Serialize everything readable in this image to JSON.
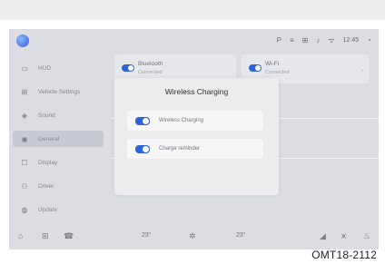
{
  "status": {
    "icons": [
      "P",
      "≡",
      "⊞",
      "♪",
      "ᯤ",
      "◔"
    ],
    "time": "12:45"
  },
  "sidebar": {
    "items": [
      {
        "icon": "▭",
        "label": "HUD"
      },
      {
        "icon": "⊞",
        "label": "Vehicle Settings"
      },
      {
        "icon": "◈",
        "label": "Sound"
      },
      {
        "icon": "◉",
        "label": "General"
      },
      {
        "icon": "☐",
        "label": "Display"
      },
      {
        "icon": "⚇",
        "label": "Driver"
      },
      {
        "icon": "◍",
        "label": "Update"
      }
    ]
  },
  "cards": [
    {
      "title": "Bluetooth",
      "subtitle": "Connected"
    },
    {
      "title": "Wi-Fi",
      "subtitle": "Connected"
    }
  ],
  "dialog": {
    "title": "Wireless Charging",
    "options": [
      {
        "label": "Wireless Charging",
        "on": true
      },
      {
        "label": "Charge reminder",
        "on": true
      }
    ]
  },
  "bottom": {
    "home": "⌂",
    "grid": "⊞",
    "phone": "☎",
    "temp_left": "23°",
    "fan": "✲",
    "temp_right": "23°",
    "seat": "◢",
    "defrost": "⩙",
    "heat": "♨"
  },
  "watermark": "OMT18-2112",
  "colors": {
    "accent": "#2f63d8",
    "screen_bg": "#dcdde2",
    "dialog_bg": "#ececef"
  }
}
